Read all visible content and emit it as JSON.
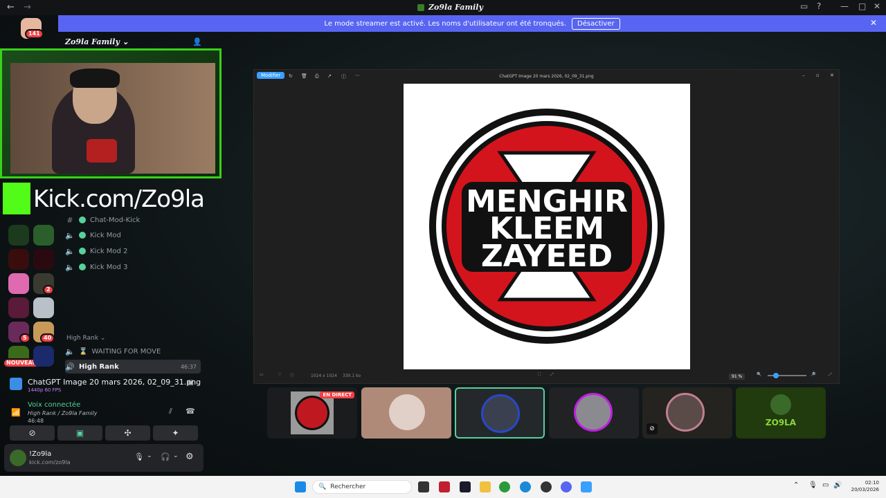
{
  "window": {
    "title": "Zo9la Family"
  },
  "banner": {
    "text": "Le mode streamer est activé. Les noms d'utilisateur ont été tronqués.",
    "button": "Désactiver"
  },
  "guild_list": {
    "top_badge": "141",
    "badge_2": "2",
    "badge_5": "5",
    "badge_40": "40",
    "badge_new": "NOUVEAU"
  },
  "server": {
    "name": "Zo9la Family"
  },
  "channels": [
    {
      "name": "Chat-Mod-Kick",
      "icon": "hash-icon"
    },
    {
      "name": "Kick Mod",
      "icon": "speaker-icon"
    },
    {
      "name": "Kick Mod 2",
      "icon": "speaker-icon"
    },
    {
      "name": "Kick Mod 3",
      "icon": "speaker-icon"
    }
  ],
  "categories": {
    "high_rank": "High Rank"
  },
  "channels_2": [
    {
      "name": "WAITING FOR MOVE",
      "icon": "speaker-icon"
    },
    {
      "name": "High Rank",
      "icon": "speaker-icon",
      "time": "46:37"
    }
  ],
  "overlay": {
    "kick_text": "Kick.com/Zo9la"
  },
  "stream": {
    "title": "ChatGPT Image 20 mars 2026, 02_09_31.png",
    "quality": "1440p 60 FPS"
  },
  "voice": {
    "status": "Voix connectée",
    "channel": "High Rank / Zo9la Family",
    "timer": "46:48"
  },
  "user": {
    "name": "!Zo9la",
    "status": "kick.com/zo9la"
  },
  "viewer": {
    "title": "ChatGPT Image 20 mars 2026, 02_09_31.png",
    "modify_label": "Modifier",
    "dims": "1024 x 1024",
    "size": "330.1 ko",
    "zoom": "91 %"
  },
  "logo": {
    "line1": "MENGHIR",
    "line2": "KLEEM",
    "line3": "ZAYEED"
  },
  "tiles": {
    "live_badge": "EN DIRECT",
    "last_name": "ZO9LA"
  },
  "taskbar": {
    "search": "Rechercher",
    "time": "02:10",
    "date": "20/03/2026"
  },
  "colors": {
    "accent": "#5865f2",
    "kick": "#53fc18",
    "online": "#57d19c",
    "live": "#f23f43"
  }
}
